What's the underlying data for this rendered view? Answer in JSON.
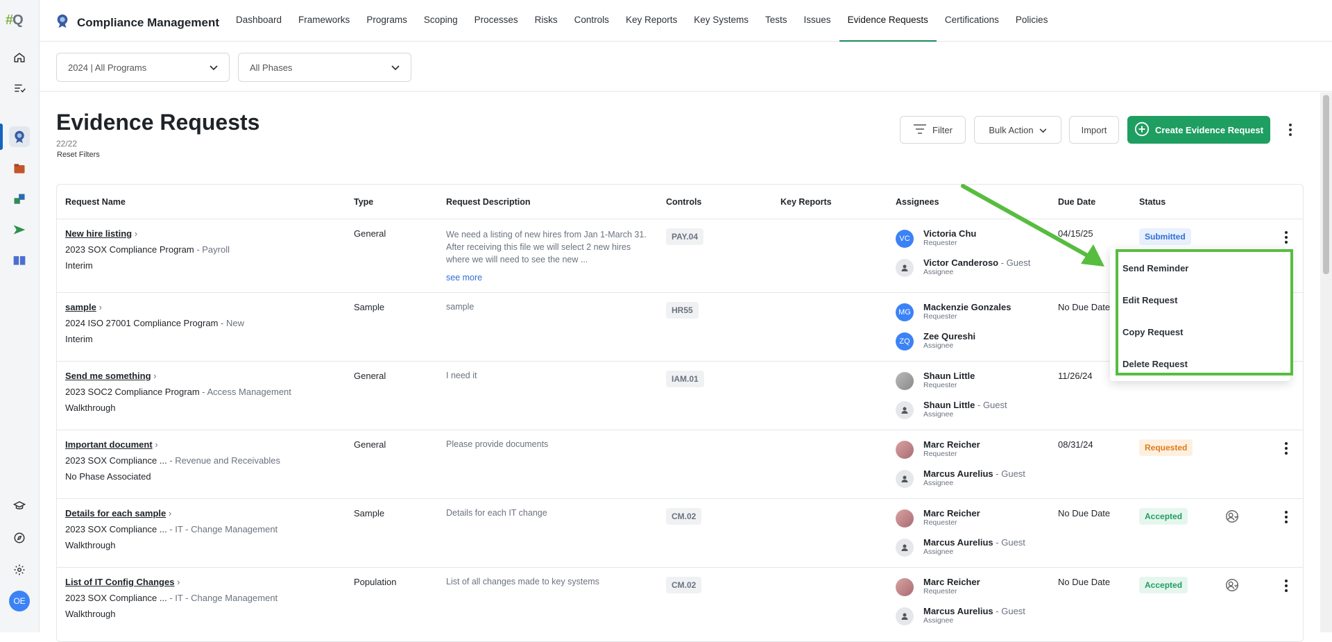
{
  "rail": {
    "logo_hash": "#",
    "logo_q": "Q",
    "user_initials": "OE"
  },
  "header": {
    "app_title": "Compliance Management",
    "nav": [
      "Dashboard",
      "Frameworks",
      "Programs",
      "Scoping",
      "Processes",
      "Risks",
      "Controls",
      "Key Reports",
      "Key Systems",
      "Tests",
      "Issues",
      "Evidence Requests",
      "Certifications",
      "Policies"
    ],
    "active_nav": "Evidence Requests"
  },
  "filters": {
    "program": "2024 | All Programs",
    "phase": "All Phases"
  },
  "page": {
    "title": "Evidence Requests",
    "count": "22/22",
    "reset": "Reset Filters",
    "filter_btn": "Filter",
    "bulk_btn": "Bulk Action",
    "import_btn": "Import",
    "create_btn": "Create Evidence Request"
  },
  "table": {
    "headers": [
      "Request Name",
      "Type",
      "Request Description",
      "Controls",
      "Key Reports",
      "Assignees",
      "Due Date",
      "Status"
    ],
    "rows": [
      {
        "name": "New hire listing",
        "program": "2023 SOX Compliance Program",
        "program_sub": " - Payroll",
        "phase": "Interim",
        "type": "General",
        "desc": "We need a listing of new hires from Jan 1-March 31. After receiving this file we will select 2 new hires where we will need to see the new ...",
        "see_more": "see more",
        "control": "PAY.04",
        "a1_initials": "VC",
        "a1_name": "Victoria Chu",
        "a1_role": "Requester",
        "a2_initials": "",
        "a2_name": "Victor Canderoso",
        "a2_suffix": " - Guest",
        "a2_role": "Assignee",
        "due": "04/15/25",
        "status": "Submitted"
      },
      {
        "name": "sample",
        "program": "2024 ISO 27001 Compliance Program",
        "program_sub": " - New",
        "phase": "Interim",
        "type": "Sample",
        "desc": "sample",
        "see_more": "",
        "control": "HR55",
        "a1_initials": "MG",
        "a1_name": "Mackenzie Gonzales",
        "a1_role": "Requester",
        "a2_initials": "ZQ",
        "a2_name": "Zee Qureshi",
        "a2_suffix": "",
        "a2_role": "Assignee",
        "due": "No Due Date",
        "status": ""
      },
      {
        "name": "Send me something",
        "program": "2023 SOC2 Compliance Program",
        "program_sub": " - Access Management",
        "phase": "Walkthrough",
        "type": "General",
        "desc": "I need it",
        "see_more": "",
        "control": "IAM.01",
        "a1_initials": "",
        "a1_name": "Shaun Little",
        "a1_role": "Requester",
        "a2_initials": "",
        "a2_name": "Shaun Little",
        "a2_suffix": " - Guest",
        "a2_role": "Assignee",
        "due": "11/26/24",
        "status": ""
      },
      {
        "name": "Important document",
        "program": "2023 SOX Compliance ...",
        "program_sub": " - Revenue and Receivables",
        "phase": "No Phase Associated",
        "type": "General",
        "desc": "Please provide documents",
        "see_more": "",
        "control": "",
        "a1_initials": "",
        "a1_name": "Marc Reicher",
        "a1_role": "Requester",
        "a2_initials": "",
        "a2_name": "Marcus Aurelius",
        "a2_suffix": " - Guest",
        "a2_role": "Assignee",
        "due": "08/31/24",
        "status": "Requested"
      },
      {
        "name": "Details for each sample",
        "program": "2023 SOX Compliance ...",
        "program_sub": " - IT - Change Management",
        "phase": "Walkthrough",
        "type": "Sample",
        "desc": "Details for each IT change",
        "see_more": "",
        "control": "CM.02",
        "a1_initials": "",
        "a1_name": "Marc Reicher",
        "a1_role": "Requester",
        "a2_initials": "",
        "a2_name": "Marcus Aurelius",
        "a2_suffix": " - Guest",
        "a2_role": "Assignee",
        "due": "No Due Date",
        "status": "Accepted"
      },
      {
        "name": "List of IT Config Changes",
        "program": "2023 SOX Compliance ...",
        "program_sub": " - IT - Change Management",
        "phase": "Walkthrough",
        "type": "Population",
        "desc": "List of all changes made to key systems",
        "see_more": "",
        "control": "CM.02",
        "a1_initials": "",
        "a1_name": "Marc Reicher",
        "a1_role": "Requester",
        "a2_initials": "",
        "a2_name": "Marcus Aurelius",
        "a2_suffix": " - Guest",
        "a2_role": "Assignee",
        "due": "No Due Date",
        "status": "Accepted"
      }
    ]
  },
  "menu": {
    "items": [
      "Send Reminder",
      "Edit Request",
      "Copy Request",
      "Delete Request"
    ]
  }
}
